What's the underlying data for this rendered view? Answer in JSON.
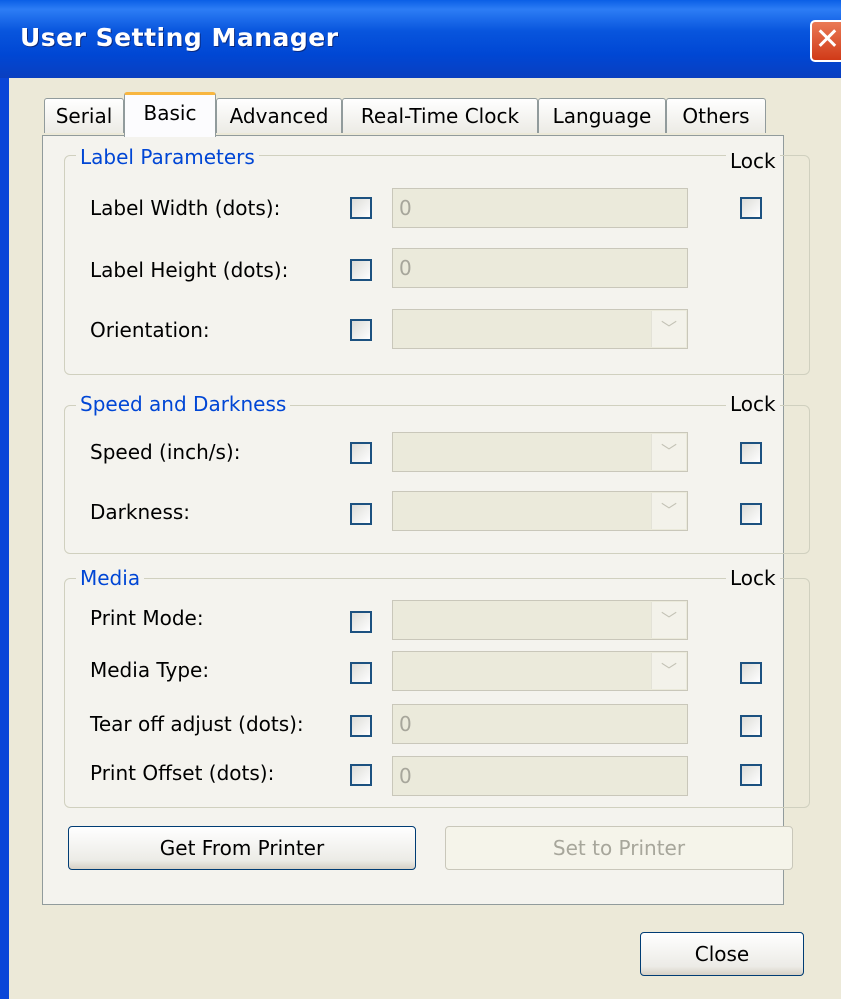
{
  "window": {
    "title": "User Setting Manager",
    "close_glyph": "✕"
  },
  "tabs": [
    {
      "label": "Serial"
    },
    {
      "label": "Basic"
    },
    {
      "label": "Advanced"
    },
    {
      "label": "Real-Time Clock"
    },
    {
      "label": "Language"
    },
    {
      "label": "Others"
    }
  ],
  "active_tab": "Basic",
  "lock_label": "Lock",
  "label_parameters": {
    "title": "Label Parameters",
    "label_width": {
      "label": "Label Width (dots):",
      "value": "0"
    },
    "label_height": {
      "label": "Label Height (dots):",
      "value": "0"
    },
    "orientation": {
      "label": "Orientation:",
      "value": ""
    }
  },
  "speed_darkness": {
    "title": "Speed and Darkness",
    "speed": {
      "label": "Speed (inch/s):",
      "value": ""
    },
    "darkness": {
      "label": "Darkness:",
      "value": ""
    }
  },
  "media": {
    "title": "Media",
    "print_mode": {
      "label": "Print Mode:",
      "value": ""
    },
    "media_type": {
      "label": "Media Type:",
      "value": ""
    },
    "tear_off": {
      "label": "Tear off adjust (dots):",
      "value": "0"
    },
    "print_offset": {
      "label": "Print Offset (dots):",
      "value": "0"
    }
  },
  "buttons": {
    "get_from_printer": "Get From Printer",
    "set_to_printer": "Set to Printer",
    "close": "Close"
  },
  "colors": {
    "titlebar": "#0855dd",
    "group_title": "#0046d5",
    "dialog_bg": "#ece9d8"
  },
  "icons": {
    "dropdown": "chevron-down-icon",
    "close": "close-icon"
  }
}
